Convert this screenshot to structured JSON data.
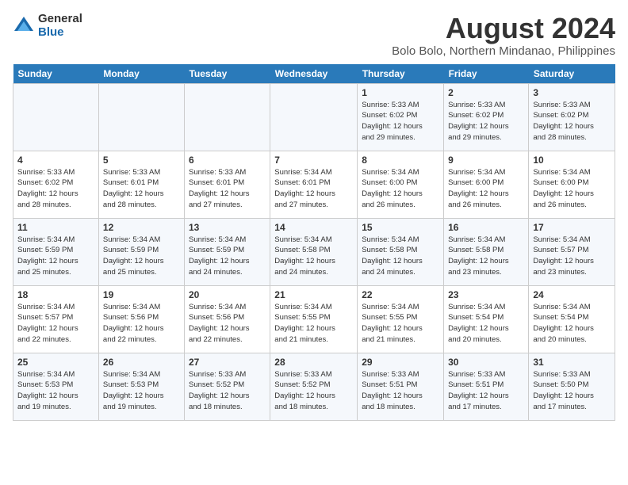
{
  "logo": {
    "general": "General",
    "blue": "Blue"
  },
  "title": "August 2024",
  "location": "Bolo Bolo, Northern Mindanao, Philippines",
  "days_of_week": [
    "Sunday",
    "Monday",
    "Tuesday",
    "Wednesday",
    "Thursday",
    "Friday",
    "Saturday"
  ],
  "weeks": [
    [
      {
        "day": "",
        "info": ""
      },
      {
        "day": "",
        "info": ""
      },
      {
        "day": "",
        "info": ""
      },
      {
        "day": "",
        "info": ""
      },
      {
        "day": "1",
        "info": "Sunrise: 5:33 AM\nSunset: 6:02 PM\nDaylight: 12 hours\nand 29 minutes."
      },
      {
        "day": "2",
        "info": "Sunrise: 5:33 AM\nSunset: 6:02 PM\nDaylight: 12 hours\nand 29 minutes."
      },
      {
        "day": "3",
        "info": "Sunrise: 5:33 AM\nSunset: 6:02 PM\nDaylight: 12 hours\nand 28 minutes."
      }
    ],
    [
      {
        "day": "4",
        "info": "Sunrise: 5:33 AM\nSunset: 6:02 PM\nDaylight: 12 hours\nand 28 minutes."
      },
      {
        "day": "5",
        "info": "Sunrise: 5:33 AM\nSunset: 6:01 PM\nDaylight: 12 hours\nand 28 minutes."
      },
      {
        "day": "6",
        "info": "Sunrise: 5:33 AM\nSunset: 6:01 PM\nDaylight: 12 hours\nand 27 minutes."
      },
      {
        "day": "7",
        "info": "Sunrise: 5:34 AM\nSunset: 6:01 PM\nDaylight: 12 hours\nand 27 minutes."
      },
      {
        "day": "8",
        "info": "Sunrise: 5:34 AM\nSunset: 6:00 PM\nDaylight: 12 hours\nand 26 minutes."
      },
      {
        "day": "9",
        "info": "Sunrise: 5:34 AM\nSunset: 6:00 PM\nDaylight: 12 hours\nand 26 minutes."
      },
      {
        "day": "10",
        "info": "Sunrise: 5:34 AM\nSunset: 6:00 PM\nDaylight: 12 hours\nand 26 minutes."
      }
    ],
    [
      {
        "day": "11",
        "info": "Sunrise: 5:34 AM\nSunset: 5:59 PM\nDaylight: 12 hours\nand 25 minutes."
      },
      {
        "day": "12",
        "info": "Sunrise: 5:34 AM\nSunset: 5:59 PM\nDaylight: 12 hours\nand 25 minutes."
      },
      {
        "day": "13",
        "info": "Sunrise: 5:34 AM\nSunset: 5:59 PM\nDaylight: 12 hours\nand 24 minutes."
      },
      {
        "day": "14",
        "info": "Sunrise: 5:34 AM\nSunset: 5:58 PM\nDaylight: 12 hours\nand 24 minutes."
      },
      {
        "day": "15",
        "info": "Sunrise: 5:34 AM\nSunset: 5:58 PM\nDaylight: 12 hours\nand 24 minutes."
      },
      {
        "day": "16",
        "info": "Sunrise: 5:34 AM\nSunset: 5:58 PM\nDaylight: 12 hours\nand 23 minutes."
      },
      {
        "day": "17",
        "info": "Sunrise: 5:34 AM\nSunset: 5:57 PM\nDaylight: 12 hours\nand 23 minutes."
      }
    ],
    [
      {
        "day": "18",
        "info": "Sunrise: 5:34 AM\nSunset: 5:57 PM\nDaylight: 12 hours\nand 22 minutes."
      },
      {
        "day": "19",
        "info": "Sunrise: 5:34 AM\nSunset: 5:56 PM\nDaylight: 12 hours\nand 22 minutes."
      },
      {
        "day": "20",
        "info": "Sunrise: 5:34 AM\nSunset: 5:56 PM\nDaylight: 12 hours\nand 22 minutes."
      },
      {
        "day": "21",
        "info": "Sunrise: 5:34 AM\nSunset: 5:55 PM\nDaylight: 12 hours\nand 21 minutes."
      },
      {
        "day": "22",
        "info": "Sunrise: 5:34 AM\nSunset: 5:55 PM\nDaylight: 12 hours\nand 21 minutes."
      },
      {
        "day": "23",
        "info": "Sunrise: 5:34 AM\nSunset: 5:54 PM\nDaylight: 12 hours\nand 20 minutes."
      },
      {
        "day": "24",
        "info": "Sunrise: 5:34 AM\nSunset: 5:54 PM\nDaylight: 12 hours\nand 20 minutes."
      }
    ],
    [
      {
        "day": "25",
        "info": "Sunrise: 5:34 AM\nSunset: 5:53 PM\nDaylight: 12 hours\nand 19 minutes."
      },
      {
        "day": "26",
        "info": "Sunrise: 5:34 AM\nSunset: 5:53 PM\nDaylight: 12 hours\nand 19 minutes."
      },
      {
        "day": "27",
        "info": "Sunrise: 5:33 AM\nSunset: 5:52 PM\nDaylight: 12 hours\nand 18 minutes."
      },
      {
        "day": "28",
        "info": "Sunrise: 5:33 AM\nSunset: 5:52 PM\nDaylight: 12 hours\nand 18 minutes."
      },
      {
        "day": "29",
        "info": "Sunrise: 5:33 AM\nSunset: 5:51 PM\nDaylight: 12 hours\nand 18 minutes."
      },
      {
        "day": "30",
        "info": "Sunrise: 5:33 AM\nSunset: 5:51 PM\nDaylight: 12 hours\nand 17 minutes."
      },
      {
        "day": "31",
        "info": "Sunrise: 5:33 AM\nSunset: 5:50 PM\nDaylight: 12 hours\nand 17 minutes."
      }
    ]
  ]
}
